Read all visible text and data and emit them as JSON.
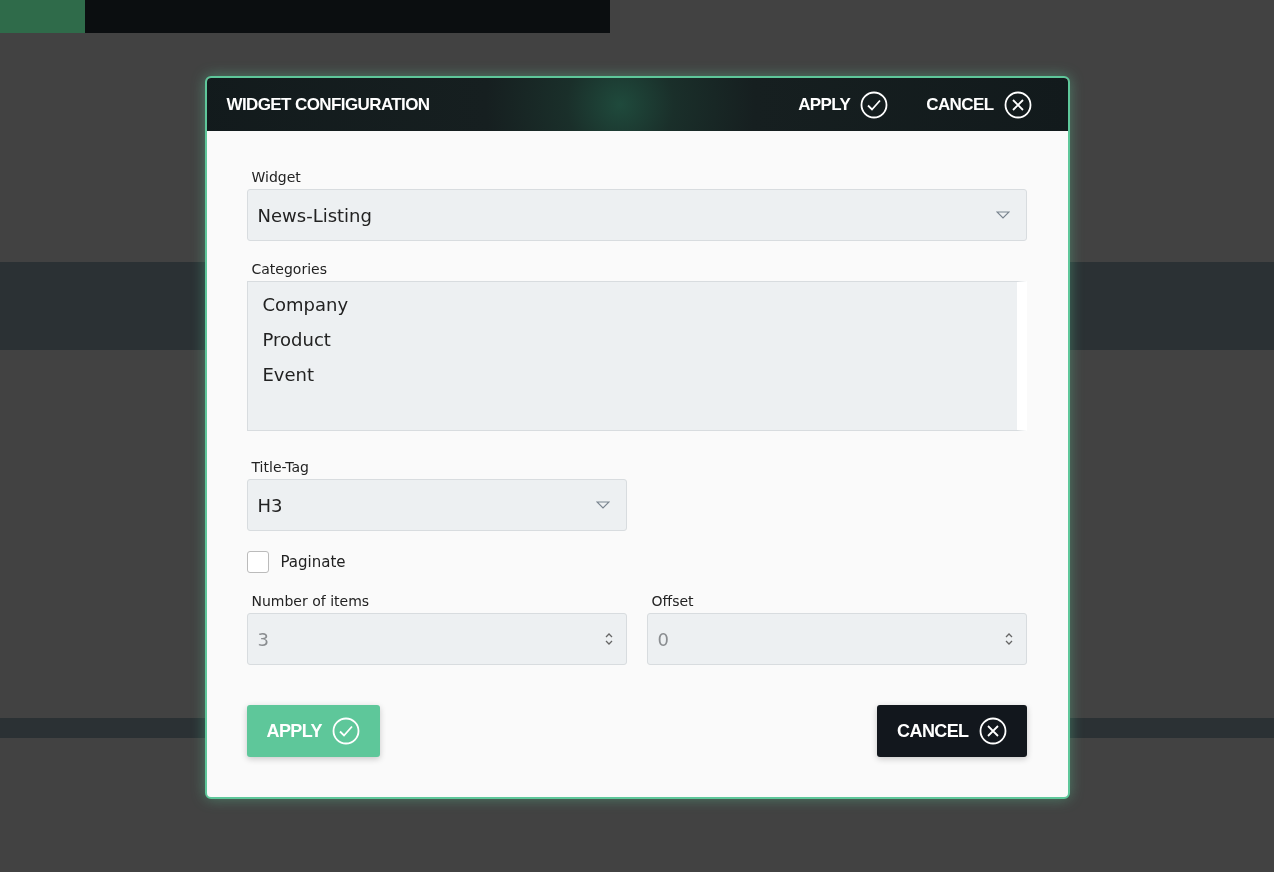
{
  "dialog": {
    "title": "WIDGET CONFIGURATION",
    "header_buttons": [
      {
        "kind": "apply",
        "label": "APPLY"
      },
      {
        "kind": "cancel",
        "label": "CANCEL"
      }
    ],
    "widget": {
      "label": "Widget",
      "value": "News-Listing"
    },
    "categories": {
      "label": "Categories",
      "options": [
        {
          "label": "Company",
          "selected": false
        },
        {
          "label": "Product",
          "selected": false
        },
        {
          "label": "Event",
          "selected": false
        }
      ]
    },
    "title_tag": {
      "label": "Title-Tag",
      "value": "H3"
    },
    "paginate": {
      "label": "Paginate",
      "checked": false
    },
    "number_fields": [
      {
        "label": "Number of items",
        "placeholder": "3"
      },
      {
        "label": "Offset",
        "placeholder": "0"
      }
    ],
    "footer_buttons": [
      {
        "kind": "apply",
        "label": "APPLY"
      },
      {
        "kind": "cancel",
        "label": "CANCEL"
      }
    ]
  }
}
